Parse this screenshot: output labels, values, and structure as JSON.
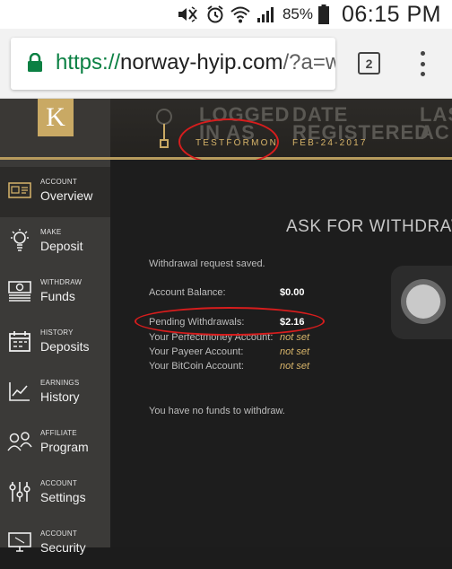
{
  "status_bar": {
    "battery_percent": "85%",
    "time": "06:15 PM"
  },
  "browser": {
    "url_scheme": "https://",
    "url_host": "norway-hyip.com",
    "url_path": "/?a=w",
    "tab_count": "2"
  },
  "header": {
    "logo_letter": "K",
    "ghost_left": "LOGGED\nIN AS",
    "ghost_mid": "DATE\nREGISTERED",
    "ghost_right": "LAS\nAC",
    "username": "TESTFORMON",
    "date_registered": "FEB-24-2017"
  },
  "sidebar": {
    "items": [
      {
        "small": "ACCOUNT",
        "big": "Overview",
        "icon": "id-card-icon"
      },
      {
        "small": "MAKE",
        "big": "Deposit",
        "icon": "lightbulb-icon"
      },
      {
        "small": "WITHDRAW",
        "big": "Funds",
        "icon": "money-icon"
      },
      {
        "small": "HISTORY",
        "big": "Deposits",
        "icon": "calendar-icon"
      },
      {
        "small": "EARNINGS",
        "big": "History",
        "icon": "chart-icon"
      },
      {
        "small": "AFFILIATE",
        "big": "Program",
        "icon": "users-icon"
      },
      {
        "small": "ACCOUNT",
        "big": "Settings",
        "icon": "sliders-icon"
      },
      {
        "small": "ACCOUNT",
        "big": "Security",
        "icon": "monitor-icon"
      }
    ]
  },
  "main": {
    "title": "ASK FOR WITHDRAW",
    "message": "Withdrawal request saved.",
    "rows": [
      {
        "label": "Account Balance:",
        "value": "$0.00"
      },
      {
        "label": "Pending Withdrawals:",
        "value": "$2.16"
      },
      {
        "label": "Your Perfectmoney Account:",
        "value": "not set"
      },
      {
        "label": "Your Payeer Account:",
        "value": "not set"
      },
      {
        "label": "Your BitCoin Account:",
        "value": "not set"
      }
    ],
    "no_funds": "You have no funds to withdraw."
  }
}
